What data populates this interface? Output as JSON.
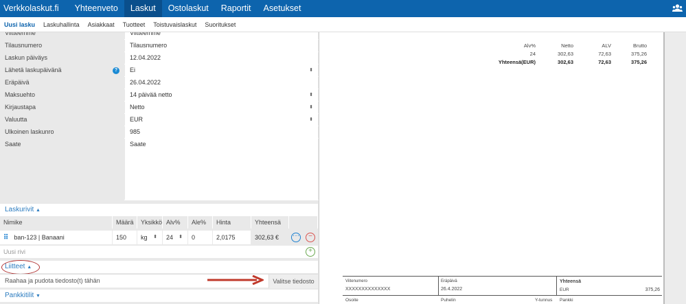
{
  "topnav": {
    "brand": "Verkkolaskut.fi",
    "items": [
      "Yhteenveto",
      "Laskut",
      "Ostolaskut",
      "Raportit",
      "Asetukset"
    ],
    "active": "Laskut",
    "user_icon": "users-icon"
  },
  "subnav": {
    "items": [
      "Uusi lasku",
      "Laskuhallinta",
      "Asiakkaat",
      "Tuotteet",
      "Toistuvaislaskut",
      "Suoritukset"
    ],
    "active": "Uusi lasku"
  },
  "form": {
    "viitteemme": {
      "label": "Viitteemme",
      "placeholder": "Viitteemme"
    },
    "tilausnumero": {
      "label": "Tilausnumero",
      "placeholder": "Tilausnumero"
    },
    "laskun_paivays": {
      "label": "Laskun päiväys",
      "value": "12.04.2022"
    },
    "laheta": {
      "label": "Lähetä laskupäivänä",
      "value": "Ei"
    },
    "erapaiva": {
      "label": "Eräpäivä",
      "value": "26.04.2022"
    },
    "maksuehto": {
      "label": "Maksuehto",
      "value": "14 päivää netto"
    },
    "kirjaustapa": {
      "label": "Kirjaustapa",
      "value": "Netto"
    },
    "valuutta": {
      "label": "Valuutta",
      "value": "EUR"
    },
    "ulkoinen": {
      "label": "Ulkoinen laskunro",
      "value": "985"
    },
    "saate": {
      "label": "Saate",
      "placeholder": "Saate"
    }
  },
  "laskurivit": {
    "title": "Laskurivit",
    "columns": [
      "Nimike",
      "Määrä",
      "Yksikkö",
      "Alv%",
      "Ale%",
      "Hinta",
      "Yhteensä"
    ],
    "rows": [
      {
        "nimike": "ban-123 | Banaani",
        "maara": "150",
        "yksikko": "kg",
        "alv": "24",
        "ale": "0",
        "hinta": "2,0175",
        "yhteensa": "302,63 €"
      }
    ],
    "new_row_placeholder": "Uusi rivi"
  },
  "liitteet": {
    "title": "Liitteet",
    "drop_text": "Raahaa ja pudota tiedosto(t) tähän",
    "choose_button": "Valitse tiedosto"
  },
  "pankkitilit": {
    "title": "Pankkitilit"
  },
  "preview": {
    "vat_table": {
      "headers": [
        "Alv%",
        "Netto",
        "ALV",
        "Brutto"
      ],
      "row": [
        "24",
        "302,63",
        "72,63",
        "375,26"
      ],
      "total": [
        "Yhteensä(EUR)",
        "302,63",
        "72,63",
        "375,26"
      ]
    },
    "footer": {
      "viitenumero_label": "Viitenumero",
      "viitenumero": "XXXXXXXXXXXXXX",
      "erapaiva_label": "Eräpäivä",
      "erapaiva": "26.4.2022",
      "yhteensa_label": "Yhteensä",
      "currency": "EUR",
      "total": "375,26",
      "osoite": "Osoite",
      "puhelin": "Puhelin",
      "ytunnus": "Y-tunnus",
      "pankki": "Pankki"
    }
  },
  "colors": {
    "brand": "#0d64ad",
    "annotation": "#c0392b"
  }
}
